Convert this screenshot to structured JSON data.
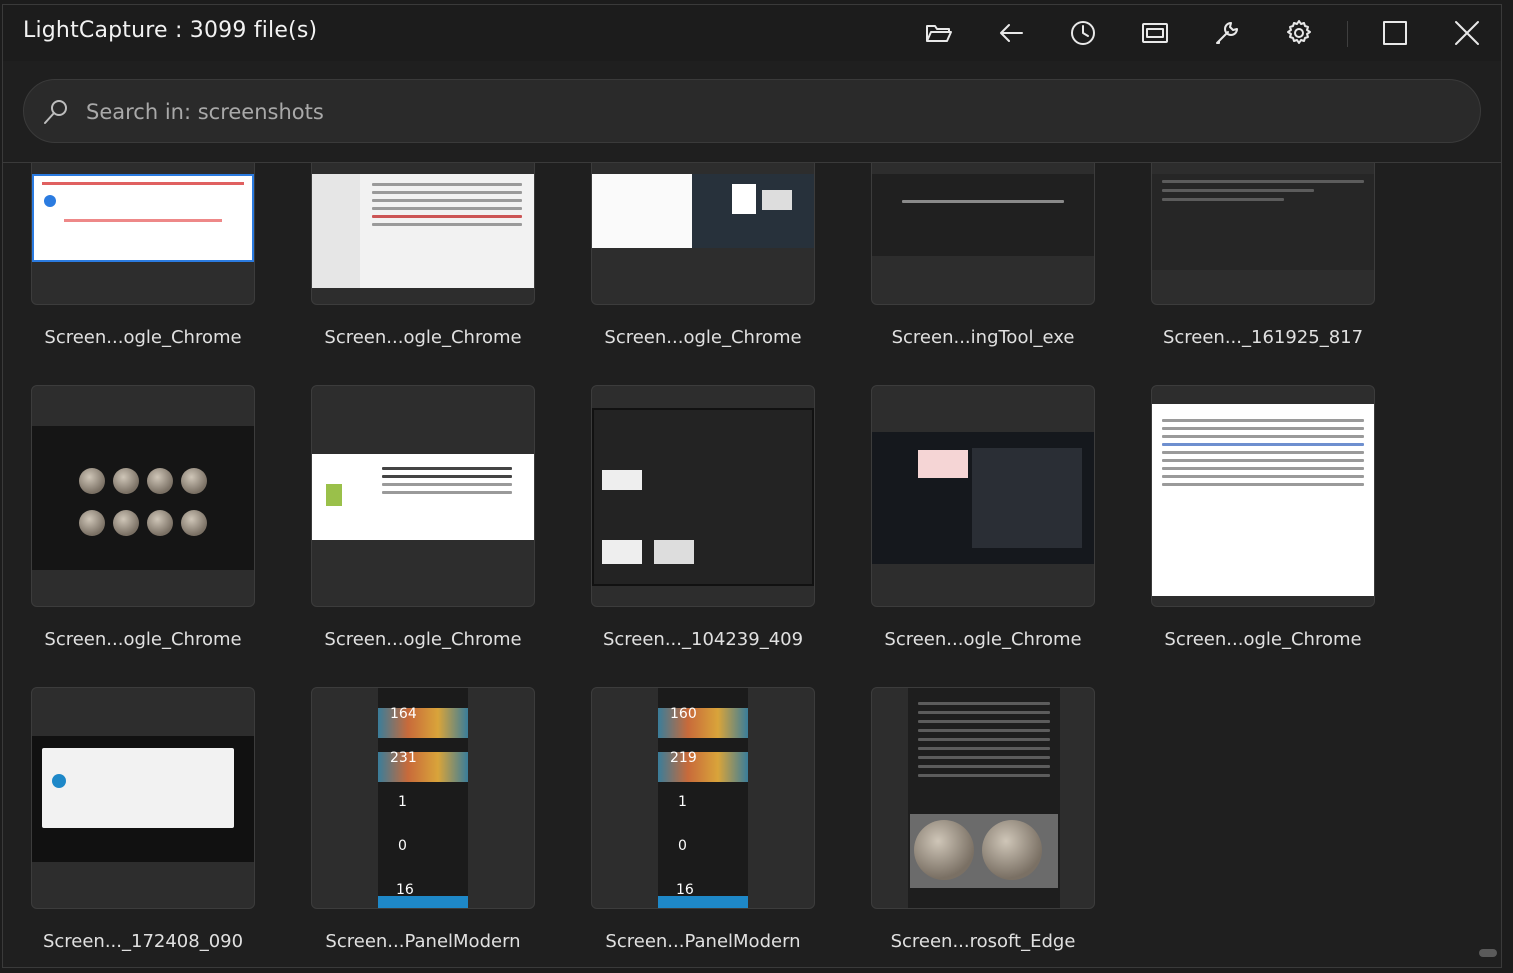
{
  "window": {
    "title": "LightCapture : 3099 file(s)"
  },
  "toolbar": {
    "icons": [
      "open-folder-icon",
      "back-arrow-icon",
      "history-icon",
      "screen-capture-icon",
      "wrench-icon",
      "gear-icon",
      "maximize-icon",
      "close-icon"
    ]
  },
  "search": {
    "placeholder": "Search in: screenshots",
    "value": ""
  },
  "files": [
    {
      "name": "Screen...ogle_Chrome"
    },
    {
      "name": "Screen...ogle_Chrome"
    },
    {
      "name": "Screen...ogle_Chrome"
    },
    {
      "name": "Screen...ingTool_exe"
    },
    {
      "name": "Screen..._161925_817"
    },
    {
      "name": "Screen...ogle_Chrome"
    },
    {
      "name": "Screen...ogle_Chrome"
    },
    {
      "name": "Screen..._104239_409"
    },
    {
      "name": "Screen...ogle_Chrome"
    },
    {
      "name": "Screen...ogle_Chrome"
    },
    {
      "name": "Screen..._172408_090"
    },
    {
      "name": "Screen...PanelModern"
    },
    {
      "name": "Screen...PanelModern"
    },
    {
      "name": "Screen...rosoft_Edge"
    }
  ],
  "panel_thumbs": [
    {
      "values": [
        "164",
        "231",
        "1",
        "0",
        "16"
      ]
    },
    {
      "values": [
        "160",
        "219",
        "1",
        "0",
        "16"
      ]
    }
  ],
  "colors": {
    "background": "#1f1f1f",
    "card": "#2d2d2d",
    "accent_blue": "#1e88c8"
  }
}
